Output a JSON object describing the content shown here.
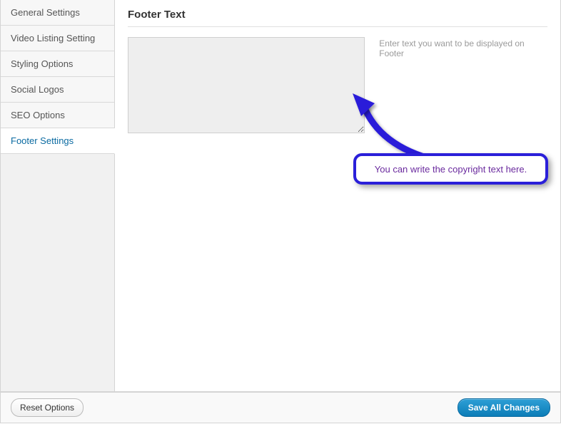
{
  "sidebar": {
    "items": [
      {
        "label": "General Settings",
        "active": false
      },
      {
        "label": "Video Listing Setting",
        "active": false
      },
      {
        "label": "Styling Options",
        "active": false
      },
      {
        "label": "Social Logos",
        "active": false
      },
      {
        "label": "SEO Options",
        "active": false
      },
      {
        "label": "Footer Settings",
        "active": true
      }
    ]
  },
  "main": {
    "section_title": "Footer Text",
    "footer_textarea_value": "",
    "helper_text": "Enter text you want to be displayed on Footer"
  },
  "callout_text": "You can write the copyright text here.",
  "buttons": {
    "reset_label": "Reset Options",
    "save_label": "Save All Changes"
  },
  "colors": {
    "arrow": "#2a1fd9",
    "accent_link": "#0a6aa1"
  }
}
